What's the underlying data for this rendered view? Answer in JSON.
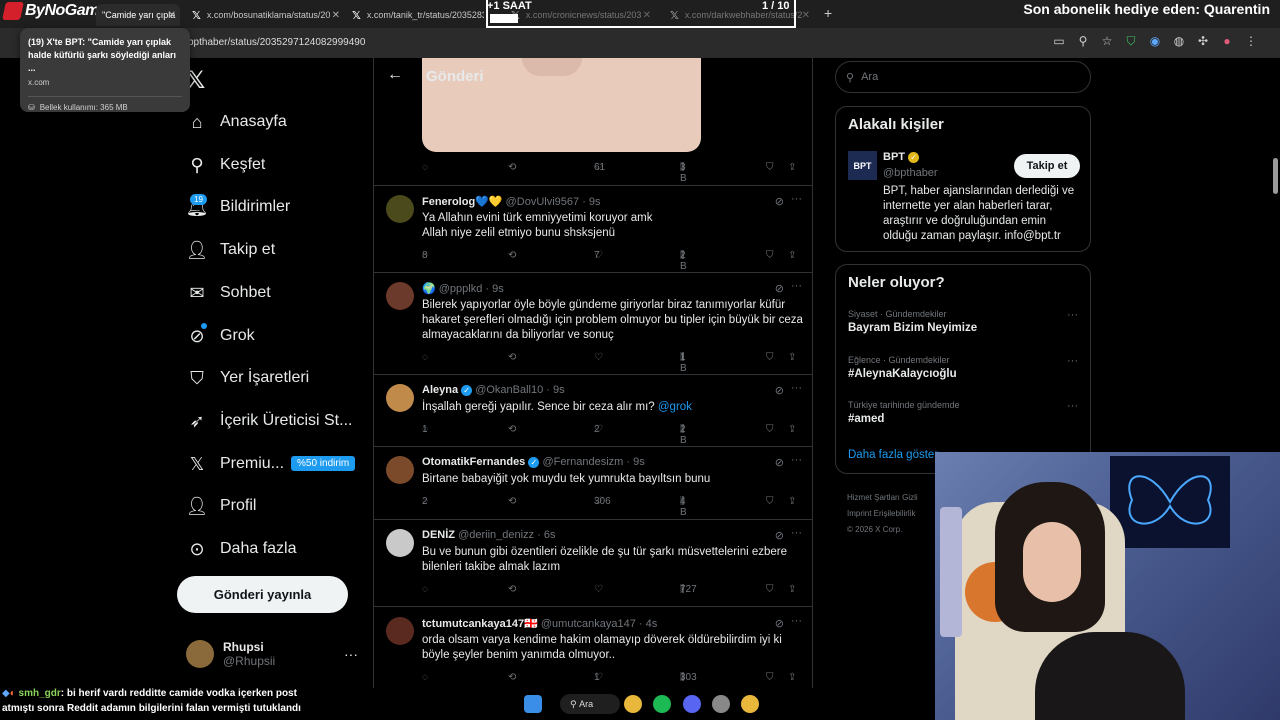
{
  "browser": {
    "tabs": [
      {
        "label": "\"Camide yarı çıpla",
        "favicon": "x-logo"
      },
      {
        "label": "x.com/bosunatiklama/status/20",
        "favicon": "x-logo"
      },
      {
        "label": "x.com/tanik_tr/status/20352837",
        "favicon": "x-logo"
      },
      {
        "label": "x.com/cronicnews/status/203",
        "favicon": "x-logo"
      },
      {
        "label": "x.com/darkwebhaber/status/2",
        "favicon": "x-logo"
      }
    ],
    "url": "bpthaber/status/2035297124082999490",
    "tooltip": {
      "title": "(19) X'te BPT: \"Camide yarı çıplak halde küfürlü şarkı söylediği anları ...",
      "domain": "x.com",
      "memory": "Bellek kullanımı: 365 MB"
    }
  },
  "overlay": {
    "brand": "ByNoGame",
    "timer_label": "+1 SAAT",
    "timer_count": "1  / 10",
    "sub_banner": "Son abonelik hediye eden: Quarentin"
  },
  "nav": {
    "items": [
      {
        "label": "Anasayfa",
        "icon": "home-icon"
      },
      {
        "label": "Keşfet",
        "icon": "search-icon"
      },
      {
        "label": "Bildirimler",
        "icon": "bell-icon"
      },
      {
        "label": "Takip et",
        "icon": "follow-icon"
      },
      {
        "label": "Sohbet",
        "icon": "mail-icon"
      },
      {
        "label": "Grok",
        "icon": "grok-icon"
      },
      {
        "label": "Yer İşaretleri",
        "icon": "bookmark-icon"
      },
      {
        "label": "İçerik Üreticisi St...",
        "icon": "rocket-icon"
      },
      {
        "label": "Premiu...",
        "icon": "x-icon"
      },
      {
        "label": "Profil",
        "icon": "profile-icon"
      },
      {
        "label": "Daha fazla",
        "icon": "more-icon"
      }
    ],
    "notif_badge": "19",
    "premium_badge": "%50 indirim",
    "post_button": "Gönderi yayınla",
    "profile": {
      "name": "Rhupsi",
      "handle": "@Rhupsii"
    }
  },
  "main": {
    "title": "Gönderi",
    "top_actions": {
      "like": "61",
      "views": "3 B"
    },
    "replies": [
      {
        "name": "Fenerolog💙💛",
        "handle": "@DovUlvi9567 · 9s",
        "text": "Ya Allahın evini türk emniyyetimi koruyor amk\nAllah niye zelil etmiyo bunu shsksjenü",
        "reply": "8",
        "like": "7",
        "views": "2 B",
        "verified": false
      },
      {
        "name": "🌍",
        "handle": "@ppplkd · 9s",
        "text": "Bilerek yapıyorlar öyle böyle gündeme giriyorlar biraz tanımıyorlar küfür hakaret  şerefleri olmadığı için problem olmuyor bu tipler için büyük bir ceza almayacaklarını da biliyorlar  ve sonuç",
        "reply": "",
        "like": "",
        "views": "1 B",
        "verified": false
      },
      {
        "name": "Aleyna",
        "handle": "@OkanBall10 · 9s",
        "text": "İnşallah gereği yapılır. Sence bir ceza alır mı? ",
        "mention": "@grok",
        "reply": "1",
        "like": "2",
        "views": "2 B",
        "verified": true
      },
      {
        "name": "OtomatikFernandes",
        "handle": "@Fernandesizm · 9s",
        "text": "Birtane babayiğit yok muydu tek yumrukta bayıltsın bunu",
        "reply": "2",
        "like": "306",
        "views": "4 B",
        "verified": true
      },
      {
        "name": "DENİZ",
        "handle": "@deriin_denizz · 6s",
        "text": "Bu ve bunun gibi özentileri özelikle de şu tür şarkı müsvettelerini ezbere bilenleri takibe almak lazım",
        "reply": "",
        "like": "",
        "views": "727",
        "verified": false
      },
      {
        "name": "tctumutcankaya147🇬🇪",
        "handle": "@umutcankaya147 · 4s",
        "text": "orda olsam varya kendime hakim olamayıp döverek öldürebilirdim iyi ki böyle şeyler benim yanımda olmuyor..",
        "reply": "",
        "like": "1",
        "views": "303",
        "verified": false
      }
    ]
  },
  "right": {
    "search_placeholder": "Ara",
    "related_title": "Alakalı kişiler",
    "bpt": {
      "logo": "BPT",
      "name": "BPT",
      "handle": "@bpthaber",
      "follow": "Takip et",
      "bio": "BPT, haber ajanslarından derlediği ve internette yer alan haberleri tarar, araştırır ve doğruluğundan emin olduğu zaman paylaşır. info@bpt.tr"
    },
    "trends_title": "Neler oluyor?",
    "trends": [
      {
        "category": "Siyaset · Gündemdekiler",
        "name": "Bayram Bizim Neyimize"
      },
      {
        "category": "Eğlence · Gündemdekiler",
        "name": "#AleynaKalaycıoğlu"
      },
      {
        "category": "Türkiye tarihinde gündemde",
        "name": "#amed"
      }
    ],
    "show_more": "Daha fazla göster",
    "footer": {
      "line1": "Hizmet Şartları   Gizli",
      "line2": "Imprint   Erişilebilirlik",
      "line3": "© 2026 X Corp."
    }
  },
  "chat": {
    "user": "smh_gdr",
    "message": ": bi herif vardı redditte camide vodka içerken post atmıştı sonra Reddit adamın bilgilerini falan vermişti tutuklandı"
  },
  "taskbar": {
    "search_label": "Ara"
  }
}
